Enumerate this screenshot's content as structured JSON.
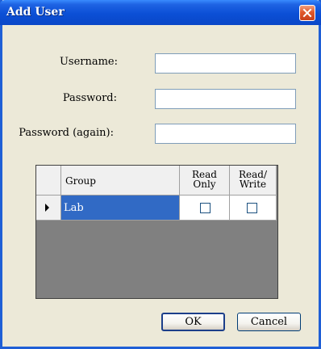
{
  "window": {
    "title": "Add User"
  },
  "form": {
    "username_label": "Username:",
    "username_value": "",
    "password_label": "Password:",
    "password_value": "",
    "password_again_label": "Password (again):",
    "password_again_value": ""
  },
  "grid": {
    "columns": {
      "group": "Group",
      "read_only_1": "Read",
      "read_only_2": "Only",
      "read_write_1": "Read/",
      "read_write_2": "Write"
    },
    "rows": [
      {
        "group": "Lab",
        "read_only": false,
        "read_write": false,
        "selected": true
      }
    ]
  },
  "buttons": {
    "ok": "OK",
    "cancel": "Cancel"
  },
  "colors": {
    "title_bar": "#0a4fd6",
    "selection": "#316ac5",
    "grid_background": "#808080",
    "dialog_background": "#ece9d8"
  }
}
